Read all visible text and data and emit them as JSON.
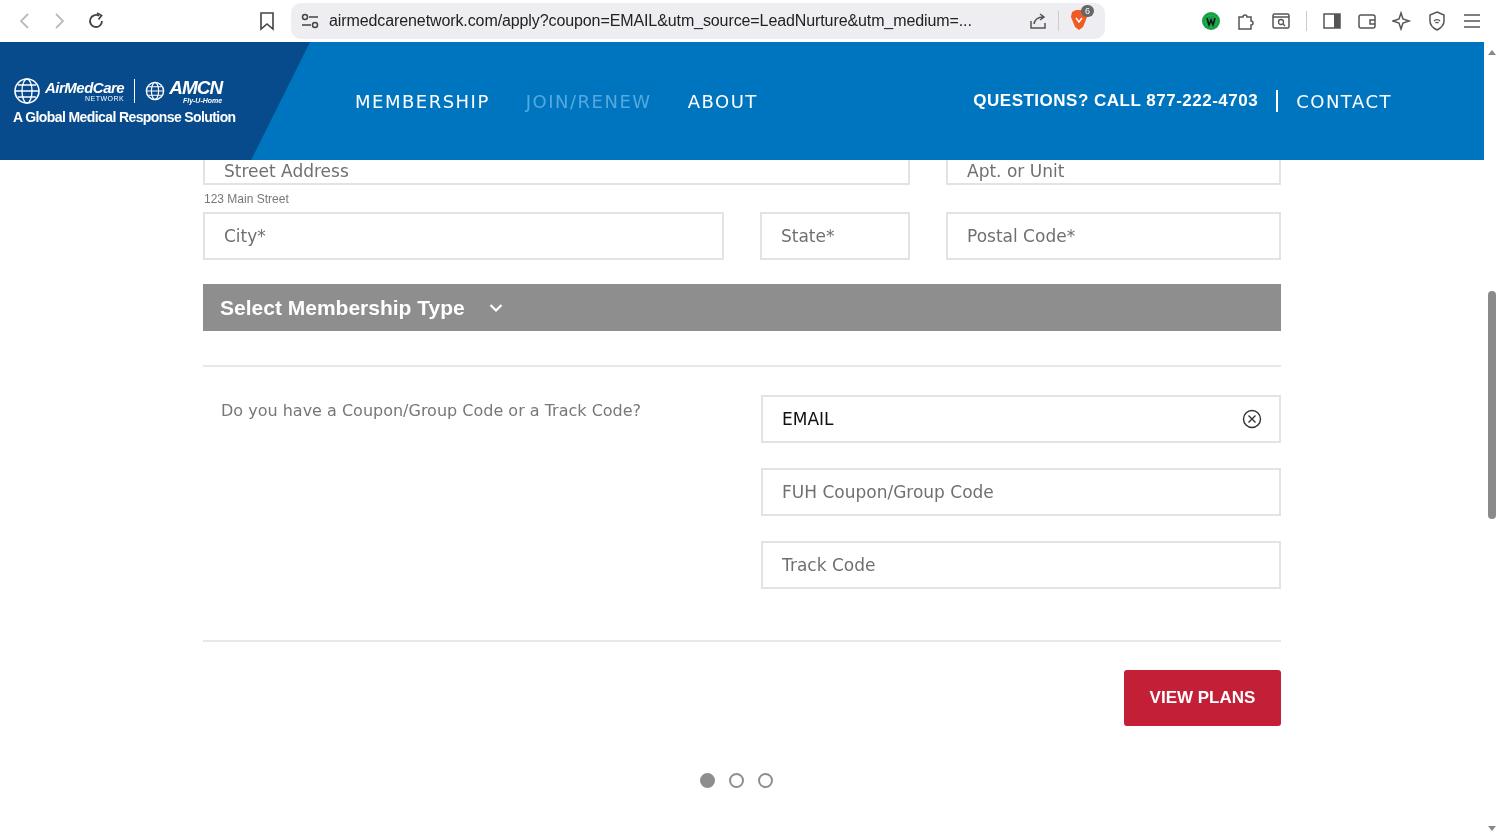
{
  "browser": {
    "url": "airmedcarenetwork.com/apply?coupon=EMAIL&utm_source=LeadNurture&utm_medium=...",
    "shields_count": "6"
  },
  "header": {
    "logo": {
      "brand": "AirMedCare",
      "brand_sub": "NETWORK",
      "partner": "AMCN",
      "partner_sub": "Fly-U-Home",
      "tagline": "A Global Medical Response Solution"
    },
    "nav": [
      {
        "label": "MEMBERSHIP",
        "selected": false
      },
      {
        "label": "JOIN/RENEW",
        "selected": true
      },
      {
        "label": "ABOUT",
        "selected": false
      }
    ],
    "phone": "QUESTIONS? CALL 877-222-4703",
    "contact": "CONTACT"
  },
  "address": {
    "street": {
      "placeholder": "Street Address",
      "hint": "123 Main Street"
    },
    "apt": {
      "placeholder": "Apt. or Unit"
    },
    "city": {
      "placeholder": "City*"
    },
    "state": {
      "placeholder": "State*"
    },
    "postal": {
      "placeholder": "Postal Code*"
    }
  },
  "membership_type": {
    "label": "Select Membership Type"
  },
  "codes": {
    "question": "Do you have a Coupon/Group Code or a Track Code?",
    "fields": [
      {
        "value": "EMAIL",
        "clearable": true
      },
      {
        "placeholder": "FUH Coupon/Group Code",
        "clearable": false
      },
      {
        "placeholder": "Track Code",
        "clearable": false
      }
    ]
  },
  "submit": "VIEW PLANS",
  "steps": [
    {
      "selected": true
    },
    {
      "selected": false
    },
    {
      "selected": false
    }
  ]
}
